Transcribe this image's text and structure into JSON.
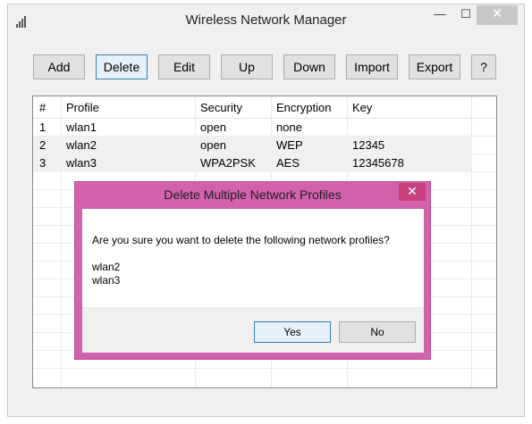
{
  "window": {
    "title": "Wireless Network Manager",
    "app_icon": "signal-bars-icon",
    "minimize_glyph": "—",
    "maximize_glyph": "☐",
    "close_glyph": "✕"
  },
  "toolbar": {
    "buttons": [
      {
        "label": "Add"
      },
      {
        "label": "Delete"
      },
      {
        "label": "Edit"
      },
      {
        "label": "Up"
      },
      {
        "label": "Down"
      },
      {
        "label": "Import"
      },
      {
        "label": "Export"
      },
      {
        "label": "?"
      }
    ]
  },
  "table": {
    "columns": [
      "#",
      "Profile",
      "Security",
      "Encryption",
      "Key"
    ],
    "rows": [
      [
        "1",
        "wlan1",
        "open",
        "none",
        ""
      ],
      [
        "2",
        "wlan2",
        "open",
        "WEP",
        "12345"
      ],
      [
        "3",
        "wlan3",
        "WPA2PSK",
        "AES",
        "12345678"
      ]
    ]
  },
  "dialog": {
    "title": "Delete Multiple Network Profiles",
    "close_glyph": "✕",
    "message": "Are you sure you want to delete the following network profiles?",
    "items": [
      "wlan2",
      "wlan3"
    ],
    "yes_label": "Yes",
    "no_label": "No",
    "accent_color": "#d262ac"
  }
}
